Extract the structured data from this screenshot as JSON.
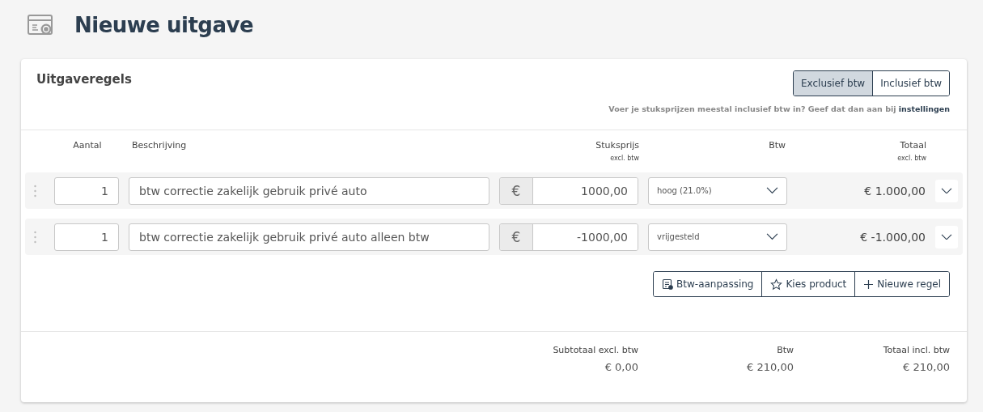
{
  "page": {
    "title": "Nieuwe uitgave"
  },
  "section": {
    "title": "Uitgaveregels"
  },
  "vat_mode": [
    {
      "label": "Exclusief btw",
      "selected": true
    },
    {
      "label": "Inclusief btw",
      "selected": false
    }
  ],
  "hint": {
    "text": "Voer je stuksprijzen meestal inclusief btw in? Geef dat dan aan bij",
    "link": "instellingen"
  },
  "columns": [
    {
      "label": "Aantal"
    },
    {
      "label": "Beschrijving"
    },
    {
      "label": "Stuksprijs",
      "sub": "excl. btw"
    },
    {
      "label": "Btw"
    },
    {
      "label": "Totaal",
      "sub": "excl. btw"
    }
  ],
  "rows": [
    {
      "quantity": "1",
      "description": "btw correctie zakelijk gebruik privé auto",
      "currency": "€",
      "price": "1000,00",
      "vat": "hoog (21.0%)",
      "total": "€ 1.000,00"
    },
    {
      "quantity": "1",
      "description": "btw correctie zakelijk gebruik privé auto alleen btw",
      "currency": "€",
      "price": "-1000,00",
      "vat": "vrijgesteld",
      "total": "€ -1.000,00"
    }
  ],
  "actions": [
    {
      "label": "Btw-aanpassing",
      "kind": "adjust"
    },
    {
      "label": "Kies product",
      "kind": "star"
    },
    {
      "label": "Nieuwe regel",
      "kind": "plus"
    }
  ],
  "summary": [
    {
      "label": "Subtotaal excl. btw",
      "value": "€ 0,00"
    },
    {
      "label": "Btw",
      "value": "€ 210,00"
    },
    {
      "label": "Totaal incl. btw",
      "value": "€ 210,00"
    }
  ]
}
